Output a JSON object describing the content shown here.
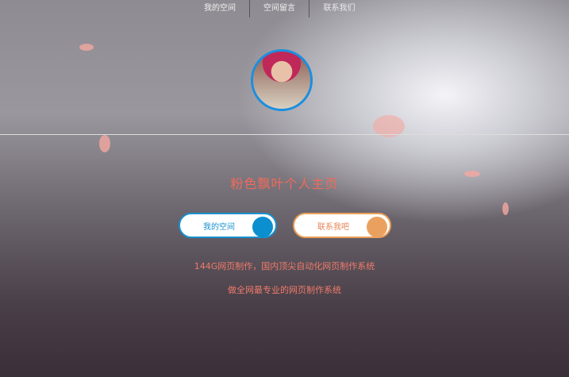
{
  "nav": {
    "items": [
      "我的空间",
      "空间留言",
      "联系我们"
    ]
  },
  "title": "粉色飘叶个人主页",
  "buttons": {
    "space": "我的空间",
    "contact": "联系我吧"
  },
  "taglines": [
    "144G网页制作，国内顶尖自动化网页制作系统",
    "做全网最专业的网页制作系统"
  ],
  "colors": {
    "title": "#f06a5a",
    "space_button": "#1791cf",
    "contact_button": "#e99e58",
    "avatar_border": "#1a8fe0"
  }
}
